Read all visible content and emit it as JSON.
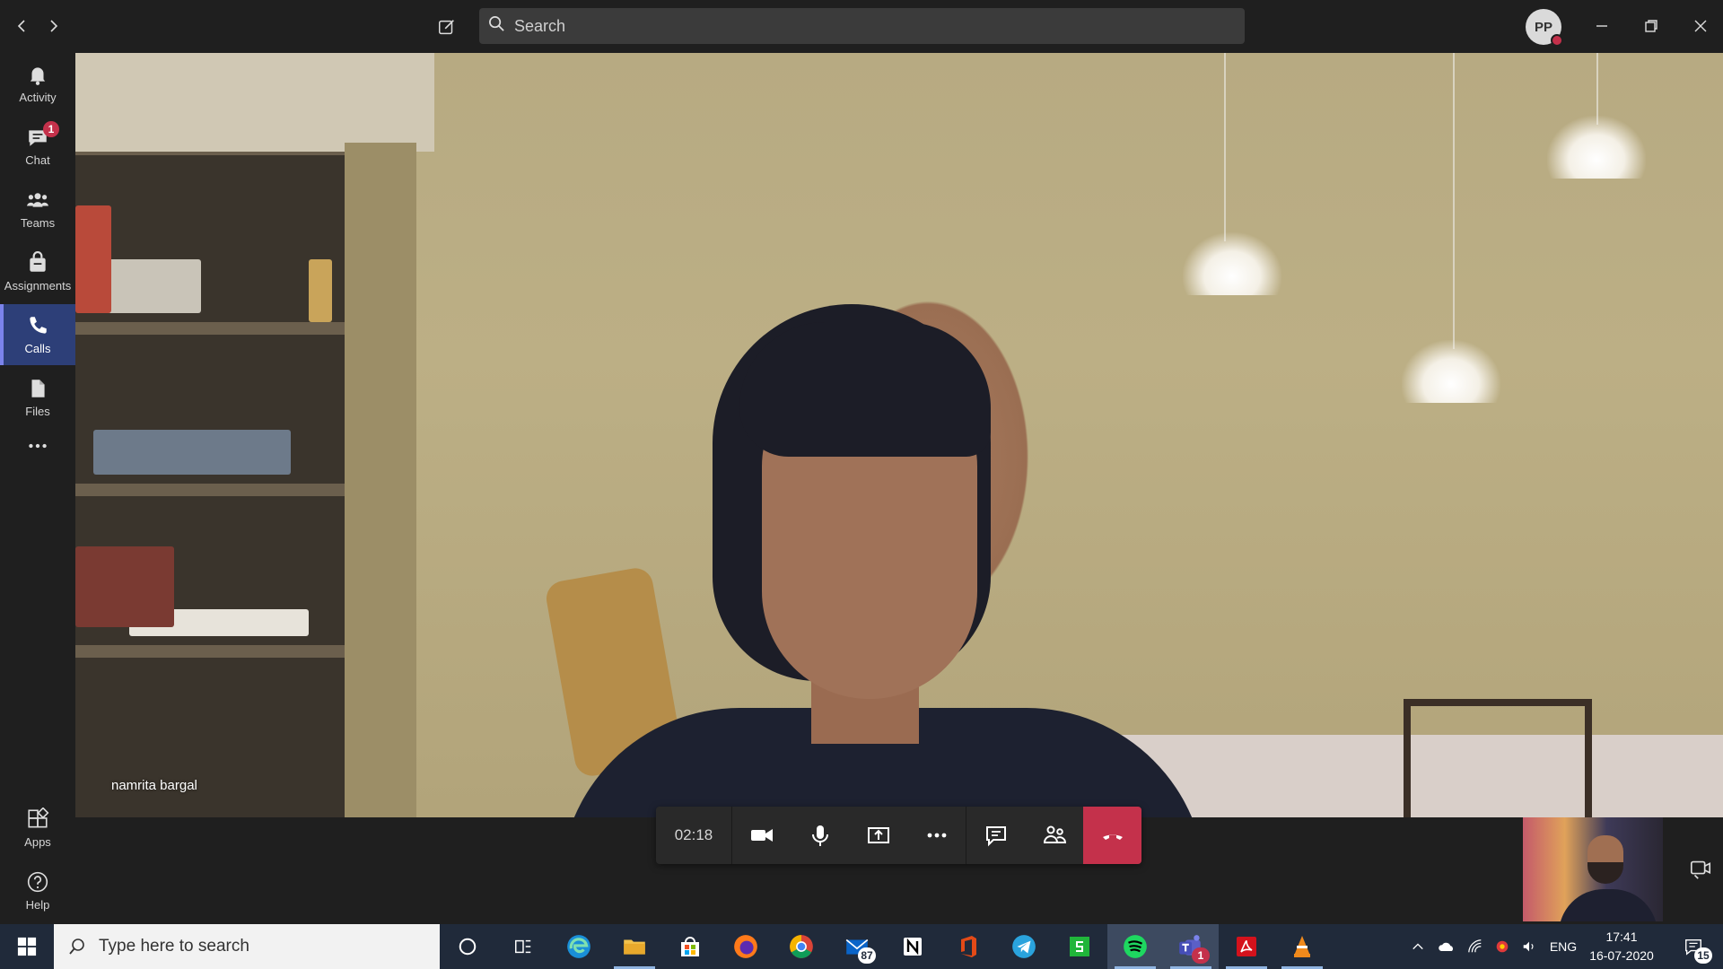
{
  "titlebar": {
    "search_placeholder": "Search",
    "avatar_initials": "PP",
    "icons": [
      "back-icon",
      "forward-icon",
      "compose-icon",
      "search-icon",
      "minimize-icon",
      "restore-icon",
      "close-icon"
    ]
  },
  "rail": {
    "items": [
      {
        "label": "Activity",
        "icon": "bell-icon"
      },
      {
        "label": "Chat",
        "icon": "chat-icon",
        "badge": "1"
      },
      {
        "label": "Teams",
        "icon": "teams-icon"
      },
      {
        "label": "Assignments",
        "icon": "assignments-icon"
      },
      {
        "label": "Calls",
        "icon": "phone-icon",
        "active": true
      },
      {
        "label": "Files",
        "icon": "files-icon"
      }
    ],
    "bottom": [
      {
        "label": "Apps",
        "icon": "apps-icon"
      },
      {
        "label": "Help",
        "icon": "help-icon"
      }
    ]
  },
  "call": {
    "participant_name": "namrita bargal",
    "timer": "02:18",
    "controls": [
      "camera-icon",
      "microphone-icon",
      "share-screen-icon",
      "more-options-icon",
      "chat-icon",
      "participants-icon",
      "hang-up-icon"
    ],
    "hangup_color": "#c4314b"
  },
  "taskbar": {
    "search_placeholder": "Type here to search",
    "mail_badge": "87",
    "teams_badge": "1",
    "language": "ENG",
    "time": "17:41",
    "date": "16-07-2020",
    "notifications_badge": "15",
    "apps": [
      "cortana",
      "task-view",
      "edge",
      "file-explorer",
      "store",
      "firefox",
      "chrome",
      "mail",
      "notion",
      "office",
      "telegram",
      "sheets",
      "spotify",
      "teams",
      "acrobat",
      "vlc"
    ]
  },
  "colors": {
    "accent": "#7b83eb",
    "rail_active": "#2d3f78",
    "background": "#1f1f1f",
    "taskbar": "#202a3a"
  }
}
